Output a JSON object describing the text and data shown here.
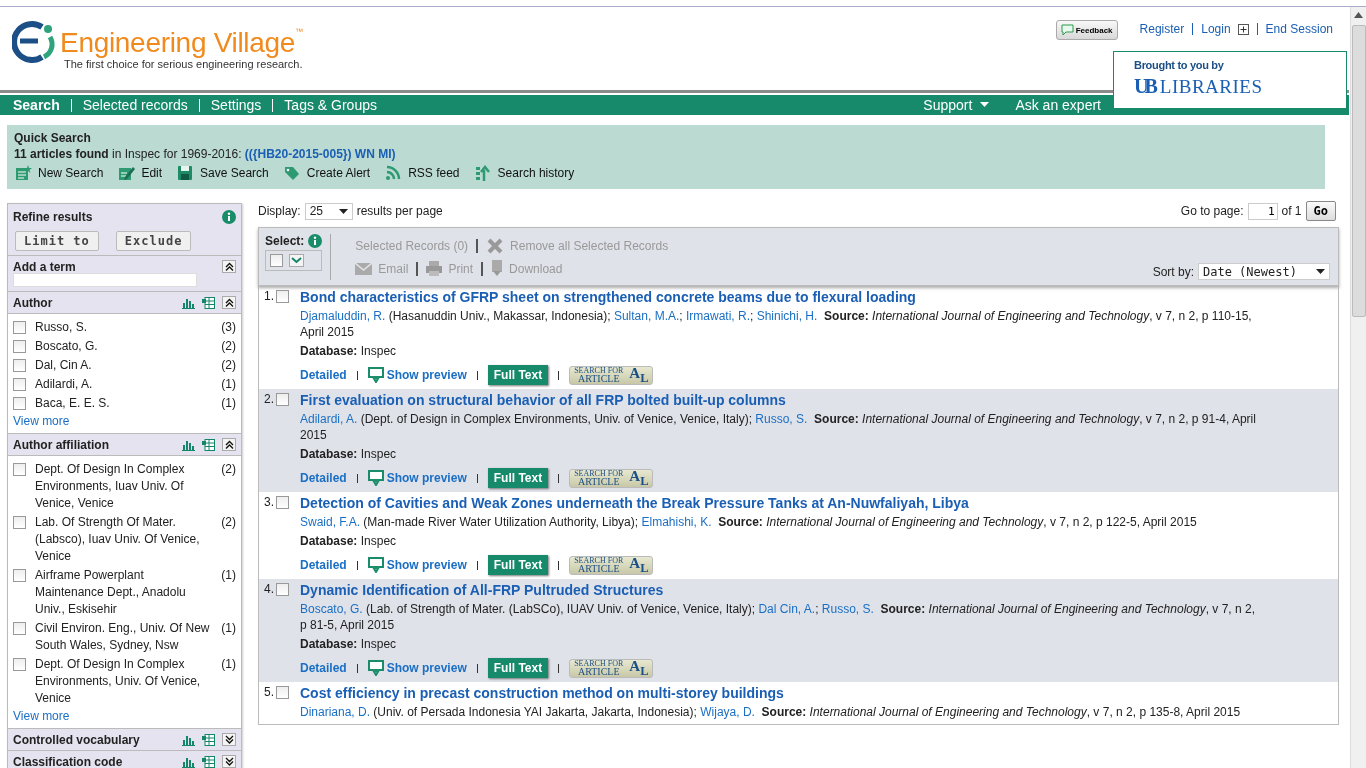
{
  "header": {
    "brand": "Engineering Village",
    "trademark": "™",
    "tagline": "The first choice for serious engineering research.",
    "feedback": "Feedback",
    "links": [
      "Register",
      "Login",
      "End Session"
    ],
    "sponsor": {
      "caption": "Brought to you by",
      "mark": "UB",
      "name": "LIBRARIES"
    }
  },
  "nav": {
    "tabs": [
      {
        "label": "Search",
        "selected": true
      },
      {
        "label": "Selected records",
        "selected": false
      },
      {
        "label": "Settings",
        "selected": false
      },
      {
        "label": "Tags & Groups",
        "selected": false
      }
    ],
    "right": [
      {
        "label": "Support",
        "dropdown": true
      },
      {
        "label": "Ask an expert",
        "dropdown": false
      }
    ]
  },
  "summary": {
    "title": "Quick Search",
    "count": "11 articles found",
    "context": "in Inspec for 1969-2016:",
    "query": "(({HB20-2015-005}) WN MI)",
    "actions": [
      {
        "kind": "new",
        "label": "New Search"
      },
      {
        "kind": "edit",
        "label": "Edit"
      },
      {
        "kind": "save",
        "label": "Save Search"
      },
      {
        "kind": "alert",
        "label": "Create Alert"
      },
      {
        "kind": "rss",
        "label": "RSS feed"
      },
      {
        "kind": "history",
        "label": "Search history"
      }
    ]
  },
  "refine": {
    "title": "Refine results",
    "buttons": [
      "Limit to",
      "Exclude"
    ],
    "facets": [
      {
        "kind": "term",
        "title": "Add a term",
        "expanded": true
      },
      {
        "kind": "list",
        "title": "Author",
        "expanded": true,
        "more": "View more",
        "items": [
          {
            "label": "Russo, S.",
            "count": "(3)",
            "checked": false
          },
          {
            "label": "Boscato, G.",
            "count": "(2)",
            "checked": false
          },
          {
            "label": "Dal, Cin A.",
            "count": "(2)",
            "checked": false
          },
          {
            "label": "Adilardi, A.",
            "count": "(1)",
            "checked": false
          },
          {
            "label": "Baca, E. E. S.",
            "count": "(1)",
            "checked": false
          }
        ]
      },
      {
        "kind": "list",
        "title": "Author affiliation",
        "expanded": true,
        "more": "View more",
        "items": [
          {
            "label": "Dept. Of Design In Complex Environments, Iuav Univ. Of Venice, Venice",
            "count": "(2)",
            "checked": false
          },
          {
            "label": "Lab. Of Strength Of Mater. (Labsco), Iuav Univ. Of Venice, Venice",
            "count": "(2)",
            "checked": false
          },
          {
            "label": "Airframe Powerplant Maintenance Dept., Anadolu Univ., Eskisehir",
            "count": "(1)",
            "checked": false
          },
          {
            "label": "Civil Environ. Eng., Univ. Of New South Wales, Sydney, Nsw",
            "count": "(1)",
            "checked": false
          },
          {
            "label": "Dept. Of Design In Complex Environments, Univ. Of Venice, Venice",
            "count": "(1)",
            "checked": false
          }
        ]
      },
      {
        "kind": "list",
        "title": "Controlled vocabulary",
        "expanded": false
      },
      {
        "kind": "list",
        "title": "Classification code",
        "expanded": false
      }
    ]
  },
  "results": {
    "display_label": "Display:",
    "display_value": "25",
    "display_suffix": "results per page",
    "goto_label": "Go to page:",
    "goto_value": "1",
    "goto_of": "of 1",
    "goto_button": "Go",
    "toolbar": {
      "select_label": "Select:",
      "select_all": false,
      "selected_records": "Selected Records (0)",
      "remove": "Remove all Selected Records",
      "email": "Email",
      "print": "Print",
      "download": "Download",
      "sort_label": "Sort by:",
      "sort_value": "Date (Newest)"
    },
    "records": [
      {
        "number": "1.",
        "checked": false,
        "title": "Bond characteristics of GFRP sheet on strengthened concrete beams due to flexural loading",
        "authors": [
          {
            "name": "Djamaluddin, R.",
            "after": " (Hasanuddin Univ., Makassar, Indonesia);"
          },
          {
            "name": "Sultan, M.A.",
            "after": ";"
          },
          {
            "name": "Irmawati, R.",
            "after": ";"
          },
          {
            "name": "Shinichi, H."
          }
        ],
        "source_label": "Source:",
        "journal": "International Journal of Engineering and Technology",
        "details": ", v 7, n 2, p 110-15, April 2015",
        "database_label": "Database:",
        "database": "Inspec",
        "links": {
          "detailed": "Detailed",
          "preview": "Show preview",
          "full_text": "Full Text",
          "linker_top": "SEARCH FOR",
          "linker_bottom": "ARTICLE",
          "linker_mark": "A$_{L}$"
        }
      },
      {
        "number": "2.",
        "checked": false,
        "title": "First evaluation on structural behavior of all FRP bolted built-up columns",
        "authors": [
          {
            "name": "Adilardi, A.",
            "after": " (Dept. of Design in Complex Environments, Univ. of Venice, Venice, Italy);"
          },
          {
            "name": "Russo, S."
          }
        ],
        "source_label": "Source:",
        "journal": "International Journal of Engineering and Technology",
        "details": ", v 7, n 2, p 91-4, April 2015",
        "database_label": "Database:",
        "database": "Inspec",
        "links": {
          "detailed": "Detailed",
          "preview": "Show preview",
          "full_text": "Full Text",
          "linker_top": "SEARCH FOR",
          "linker_bottom": "ARTICLE",
          "linker_mark": "A$_{L}$"
        }
      },
      {
        "number": "3.",
        "checked": false,
        "title": "Detection of Cavities and Weak Zones underneath the Break Pressure Tanks at An-Nuwfaliyah, Libya",
        "authors": [
          {
            "name": "Swaid, F.A.",
            "after": " (Man-made River Water Utilization Authority, Libya);"
          },
          {
            "name": "Elmahishi, K."
          }
        ],
        "source_label": "Source:",
        "journal": "International Journal of Engineering and Technology",
        "details": ", v 7, n 2, p 122-5, April 2015",
        "database_label": "Database:",
        "database": "Inspec",
        "links": {
          "detailed": "Detailed",
          "preview": "Show preview",
          "full_text": "Full Text",
          "linker_top": "SEARCH FOR",
          "linker_bottom": "ARTICLE",
          "linker_mark": "A$_{L}$"
        }
      },
      {
        "number": "4.",
        "checked": false,
        "title": "Dynamic Identification of All-FRP Pultruded Structures",
        "authors": [
          {
            "name": "Boscato, G.",
            "after": " (Lab. of Strength of Mater. (LabSCo), IUAV Univ. of Venice, Venice, Italy);"
          },
          {
            "name": "Dal Cin, A.",
            "after": ";"
          },
          {
            "name": "Russo, S."
          }
        ],
        "source_label": "Source:",
        "journal": "International Journal of Engineering and Technology",
        "details": ", v 7, n 2, p 81-5, April 2015",
        "database_label": "Database:",
        "database": "Inspec",
        "links": {
          "detailed": "Detailed",
          "preview": "Show preview",
          "full_text": "Full Text",
          "linker_top": "SEARCH FOR",
          "linker_bottom": "ARTICLE",
          "linker_mark": "A$_{L}$"
        }
      },
      {
        "number": "5.",
        "checked": false,
        "title": "Cost efficiency in precast construction method on multi-storey buildings",
        "authors": [
          {
            "name": "Dinariana, D.",
            "after": " (Univ. of Persada Indonesia YAI Jakarta, Jakarta, Indonesia);"
          },
          {
            "name": "Wijaya, D."
          }
        ],
        "source_label": "Source:",
        "journal": "International Journal of Engineering and Technology",
        "details": ", v 7, n 2, p 135-8, April 2015"
      }
    ]
  }
}
